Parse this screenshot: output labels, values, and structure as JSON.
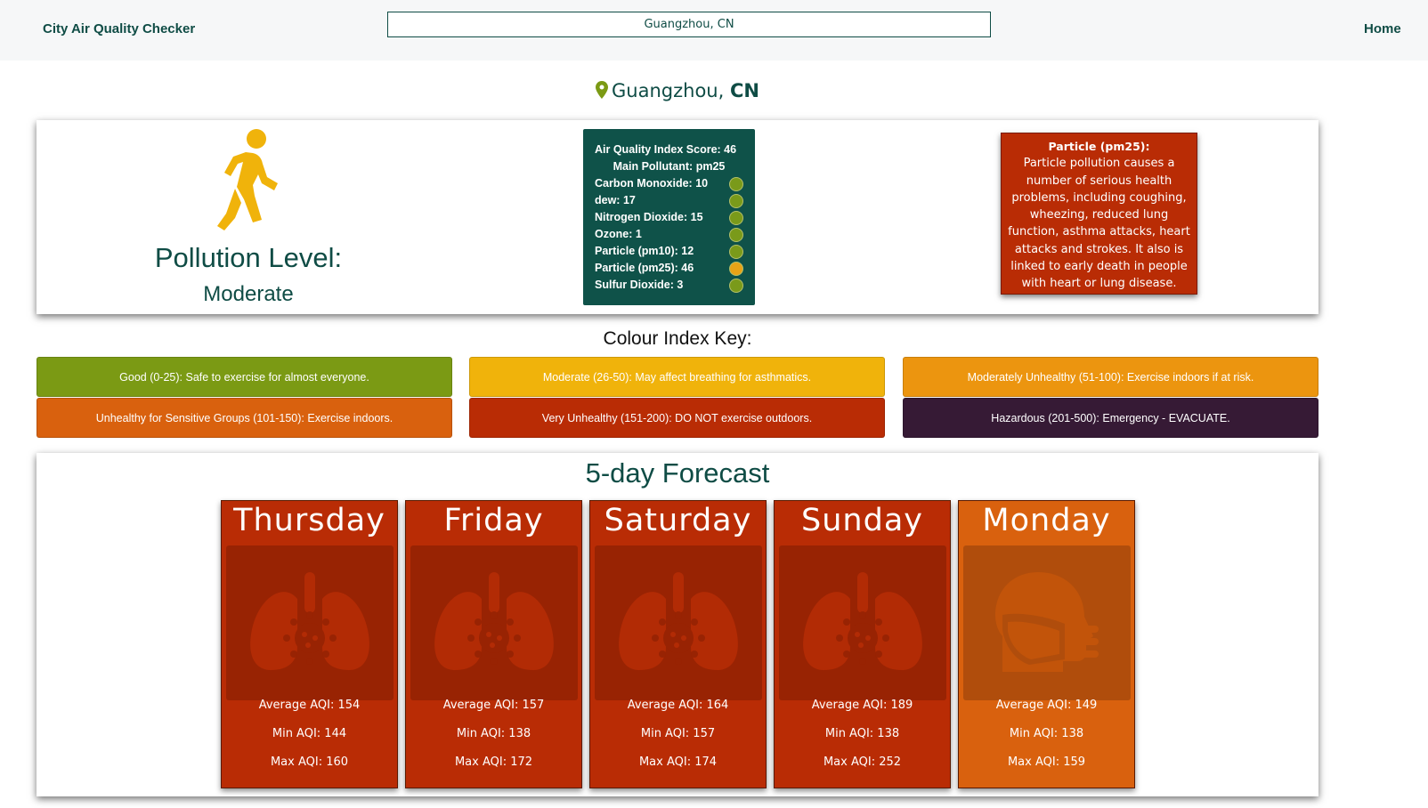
{
  "nav": {
    "title": "City Air Quality Checker",
    "search_value": "Guangzhou, CN",
    "home_label": "Home"
  },
  "location": {
    "city": "Guangzhou",
    "country": "CN"
  },
  "pollution": {
    "label": "Pollution Level:",
    "value": "Moderate"
  },
  "aqi": {
    "score_line": "Air Quality Index Score: 46",
    "main_line": "Main Pollutant: pm25",
    "rows": [
      {
        "label": "Carbon Monoxide: 10",
        "color": "#7a9a1a"
      },
      {
        "label": "dew: 17",
        "color": "#7a9a1a"
      },
      {
        "label": "Nitrogen Dioxide: 15",
        "color": "#7a9a1a"
      },
      {
        "label": "Ozone: 1",
        "color": "#7a9a1a"
      },
      {
        "label": "Particle (pm10): 12",
        "color": "#7a9a1a"
      },
      {
        "label": "Particle (pm25): 46",
        "color": "#e8a317"
      },
      {
        "label": "Sulfur Dioxide: 3",
        "color": "#7a9a1a"
      }
    ]
  },
  "particle_info": {
    "title": "Particle (pm25):",
    "text": "Particle pollution causes a number of serious health problems, including coughing, wheezing, reduced lung function, asthma attacks, heart attacks and strokes. It also is linked to early death in people with heart or lung disease."
  },
  "key": {
    "title": "Colour Index Key:",
    "items": [
      {
        "label": "Good (0-25): Safe to exercise for almost everyone.",
        "color": "#7b9a14"
      },
      {
        "label": "Moderate (26-50): May affect breathing for asthmatics.",
        "color": "#f0b30b"
      },
      {
        "label": "Moderately Unhealthy (51-100): Exercise indoors if at risk.",
        "color": "#ec950f"
      },
      {
        "label": "Unhealthy for Sensitive Groups (101-150): Exercise indoors.",
        "color": "#d9610e"
      },
      {
        "label": "Very Unhealthy (151-200): DO NOT exercise outdoors.",
        "color": "#b92c05"
      },
      {
        "label": "Hazardous (201-500): Emergency - EVACUATE.",
        "color": "#361a35"
      }
    ]
  },
  "forecast": {
    "title": "5-day Forecast",
    "days": [
      {
        "name": "Thursday",
        "avg": "Average AQI: 154",
        "min": "Min AQI: 144",
        "max": "Max AQI: 160",
        "color": "#b92c05",
        "icon": "lungs-virus-icon"
      },
      {
        "name": "Friday",
        "avg": "Average AQI: 157",
        "min": "Min AQI: 138",
        "max": "Max AQI: 172",
        "color": "#b92c05",
        "icon": "lungs-virus-icon"
      },
      {
        "name": "Saturday",
        "avg": "Average AQI: 164",
        "min": "Min AQI: 157",
        "max": "Max AQI: 174",
        "color": "#b92c05",
        "icon": "lungs-virus-icon"
      },
      {
        "name": "Sunday",
        "avg": "Average AQI: 189",
        "min": "Min AQI: 138",
        "max": "Max AQI: 252",
        "color": "#b92c05",
        "icon": "lungs-virus-icon"
      },
      {
        "name": "Monday",
        "avg": "Average AQI: 149",
        "min": "Min AQI: 138",
        "max": "Max AQI: 159",
        "color": "#d9610e",
        "icon": "masked-head-icon"
      }
    ]
  }
}
